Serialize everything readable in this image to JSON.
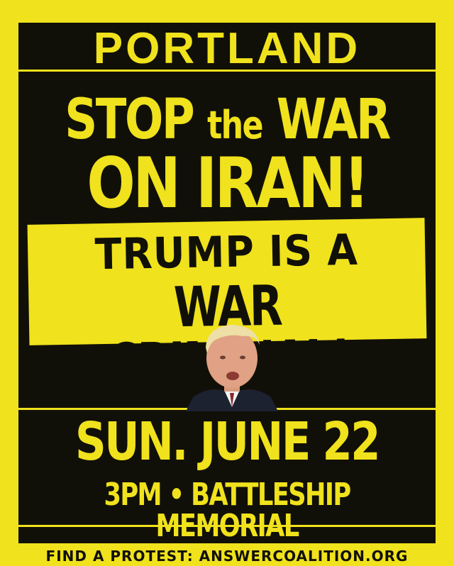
{
  "poster": {
    "city": "PORTLAND",
    "headline_stop": "STOP",
    "headline_the": "the",
    "headline_war": "WAR",
    "headline_line2": "ON IRAN!",
    "panel_line1": "TRUMP IS A",
    "panel_line2": "WAR CRIMINAL!",
    "date": "SUN. JUNE 22",
    "time_location": "3PM • BATTLESHIP MEMORIAL",
    "footer": "FIND A PROTEST: ANSWERCOALITION.ORG"
  },
  "colors": {
    "background": "#f0e21c",
    "frame": "#111008",
    "accent": "#f0e21c"
  },
  "icons": {
    "portrait": "person-portrait-icon"
  }
}
